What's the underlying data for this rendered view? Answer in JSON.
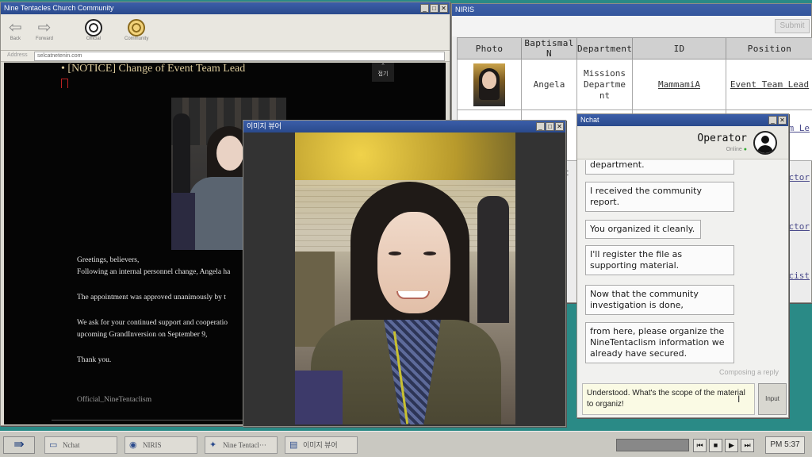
{
  "browser": {
    "title": "Nine Tentacles Church Community",
    "toolbar": {
      "back": "Back",
      "forward": "Forward",
      "official": "Official",
      "community": "Community"
    },
    "address_label": "Address",
    "address_value": "selcatnetenin.com",
    "notice_title": "[NOTICE] Change of Event Team Lead",
    "fold_label": "접기",
    "body_lines": [
      "Greetings, believers,",
      "Following an internal personnel change, Angela ha",
      "The appointment was approved unanimously by t",
      "We ask for your continued support and cooperatio",
      "upcoming GrandInversion on September 9,",
      "Thank you."
    ],
    "signature": "Official_NineTentaclism"
  },
  "niris": {
    "title": "NIRIS",
    "submit_label": "Submit",
    "columns": [
      "Photo",
      "Baptismal N",
      "Department",
      "ID",
      "Position"
    ],
    "row": {
      "baptismal_name": "Angela",
      "department": "Missions Departme nt",
      "id": "MammamiA",
      "position": "Event Team Lead"
    },
    "side_fragments": [
      "am Le",
      "ector",
      "ector",
      "acist"
    ],
    "partial_cell": "t"
  },
  "viewer": {
    "title": "이미지 뷰어"
  },
  "nchat": {
    "title": "Nchat",
    "operator_name": "Operator",
    "operator_status": "Online",
    "messages": [
      "department.",
      "I received the community report.",
      "You organized it cleanly.",
      "I'll register the file as supporting material.",
      "Now that the community investigation is done,",
      "from here, please organize the NineTentaclism information we already have secured."
    ],
    "composing": "Composing a reply",
    "draft": "Understood. What's the scope of the material to organiz!",
    "input_button": "Input"
  },
  "taskbar": {
    "tasks": [
      "Nchat",
      "NIRIS",
      "Nine Tentacl···",
      "이미지 뷰어"
    ],
    "clock": "PM 5:37"
  }
}
